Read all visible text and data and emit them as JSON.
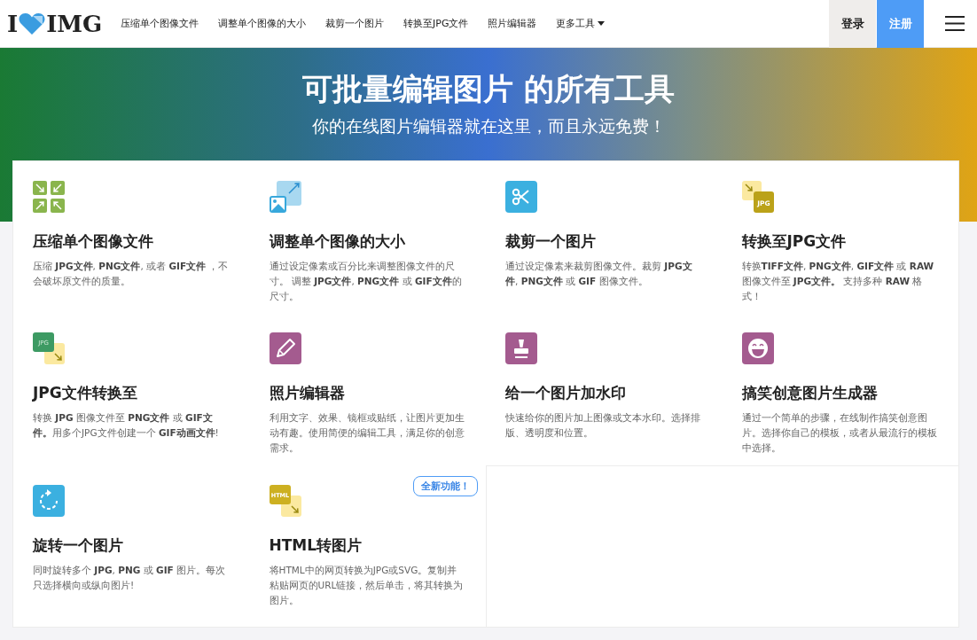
{
  "header": {
    "logo": {
      "left": "I",
      "right": "IMG"
    },
    "nav": [
      {
        "label": "压缩单个图像文件",
        "dropdown": false
      },
      {
        "label": "调整单个图像的大小",
        "dropdown": false
      },
      {
        "label": "裁剪一个图片",
        "dropdown": false
      },
      {
        "label": "转换至JPG文件",
        "dropdown": false
      },
      {
        "label": "照片编辑器",
        "dropdown": false
      },
      {
        "label": "更多工具",
        "dropdown": true
      }
    ],
    "login": "登录",
    "signup": "注册"
  },
  "hero": {
    "title": "可批量编辑图片 的所有工具",
    "subtitle": "你的在线图片编辑器就在这里，而且永远免费！"
  },
  "tools": [
    {
      "kind": "compress",
      "title": "压缩单个图像文件",
      "description": "压缩 **JPG文件**, **PNG文件**, 或者 **GIF文件** ，不会破坏原文件的质量。"
    },
    {
      "kind": "resize",
      "title": "调整单个图像的大小",
      "description": "通过设定像素或百分比来调整图像文件的尺寸。 调整 **JPG文件**, **PNG文件** 或 **GIF文件**的尺寸。"
    },
    {
      "kind": "crop",
      "title": "裁剪一个图片",
      "description": "通过设定像素来裁剪图像文件。裁剪 **JPG文件**, **PNG文件** 或 **GIF** 图像文件。"
    },
    {
      "kind": "to-jpg",
      "icon_text": "JPG",
      "title": "转换至JPG文件",
      "description": "转换**TIFF文件**, **PNG文件**, **GIF文件** 或 **RAW** 图像文件至 **JPG文件。** 支持多种 **RAW** 格式！"
    },
    {
      "kind": "from-jpg",
      "icon_text": "JPG",
      "title": "JPG文件转换至",
      "description": "转换 **JPG** 图像文件至 **PNG文件** 或 **GIF文件。**用多个JPG文件创建一个 **GIF动画文件**!"
    },
    {
      "kind": "edit",
      "title": "照片编辑器",
      "description": "利用文字、效果、镜框或贴纸，让图片更加生动有趣。使用简便的编辑工具，满足你的创意需求。"
    },
    {
      "kind": "watermark",
      "title": "给一个图片加水印",
      "description": "快速给你的图片加上图像或文本水印。选择排版、透明度和位置。"
    },
    {
      "kind": "meme",
      "title": "搞笑创意图片生成器",
      "description": "通过一个简单的步骤，在线制作搞笑创意图片。选择你自己的模板，或者从最流行的模板中选择。"
    },
    {
      "kind": "rotate",
      "title": "旋转一个图片",
      "description": "同时旋转多个 **JPG**, **PNG** 或 **GIF** 图片。每次只选择横向或纵向图片!"
    },
    {
      "kind": "html",
      "icon_text": "HTML",
      "badge": "全新功能！",
      "title": "HTML转图片",
      "description": "将HTML中的网页转换为JPG或SVG。复制并粘贴网页的URL链接，然后单击，将其转换为图片。"
    }
  ]
}
